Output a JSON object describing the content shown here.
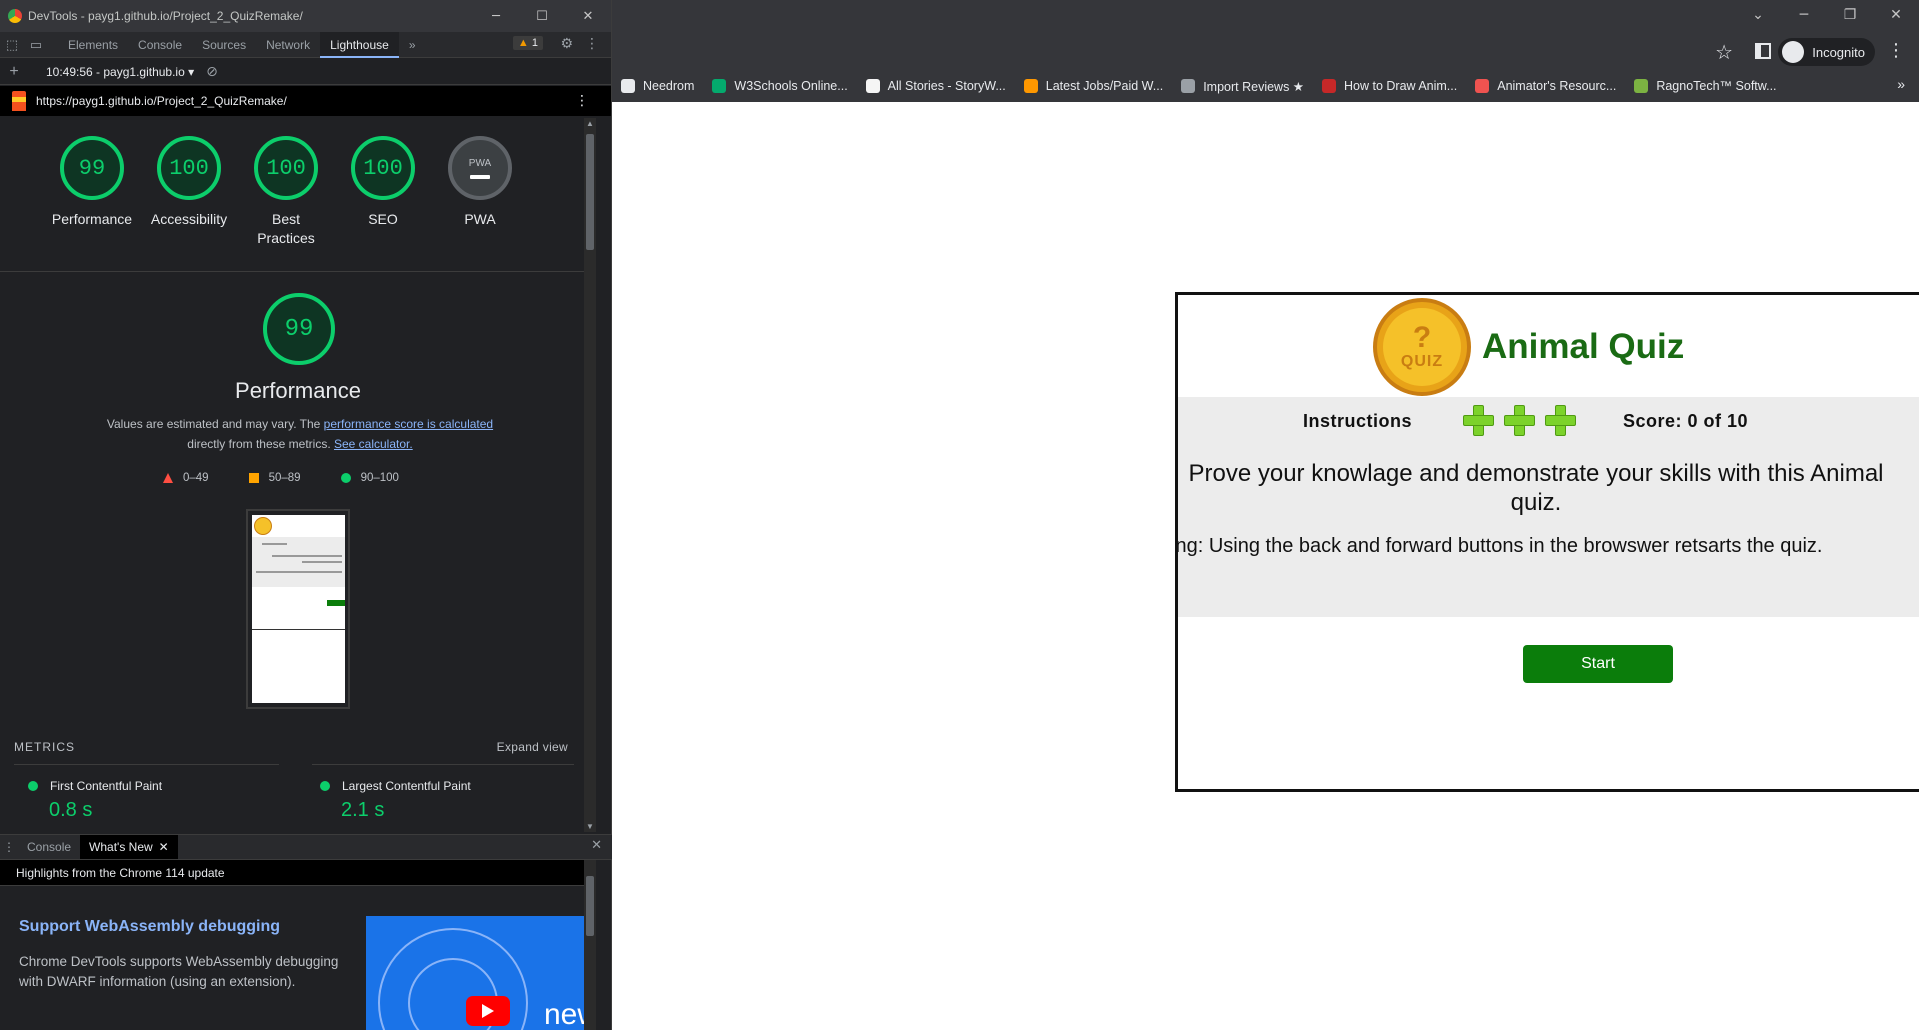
{
  "devtools": {
    "window_title": "DevTools - payg1.github.io/Project_2_QuizRemake/",
    "tabs": [
      "Elements",
      "Console",
      "Sources",
      "Network",
      "Lighthouse"
    ],
    "active_tab": "Lighthouse",
    "more_tabs": "»",
    "issues_count": "1",
    "report_selector": "10:49:56 - payg1.github.io",
    "report_url": "https://payg1.github.io/Project_2_QuizRemake/",
    "scores": [
      {
        "label": "Performance",
        "value": "99"
      },
      {
        "label": "Accessibility",
        "value": "100"
      },
      {
        "label": "Best Practices",
        "value": "100"
      },
      {
        "label": "SEO",
        "value": "100"
      }
    ],
    "pwa": {
      "label": "PWA",
      "badge": "PWA"
    },
    "performance": {
      "score": "99",
      "title": "Performance",
      "desc_1": "Values are estimated and may vary. The ",
      "desc_link_1": "performance score is calculated",
      "desc_2": " directly from these metrics. ",
      "desc_link_2": "See calculator.",
      "legend": [
        {
          "range": "0–49",
          "shape": "triangle",
          "color": "#ff4e42"
        },
        {
          "range": "50–89",
          "shape": "square",
          "color": "#ffa400"
        },
        {
          "range": "90–100",
          "shape": "circle",
          "color": "#0cce6b"
        }
      ]
    },
    "metrics": {
      "header": "METRICS",
      "expand": "Expand view",
      "items": [
        {
          "name": "First Contentful Paint",
          "value": "0.8 s"
        },
        {
          "name": "Largest Contentful Paint",
          "value": "2.1 s"
        }
      ]
    },
    "drawer": {
      "tabs": [
        "Console",
        "What's New"
      ],
      "active_tab": "What's New",
      "highlight": "Highlights from the Chrome 114 update",
      "feature_title": "Support WebAssembly debugging",
      "feature_text": "Chrome DevTools supports WebAssembly debugging with DWARF information (using an extension).",
      "video_text": "new"
    }
  },
  "browser": {
    "profile": "Incognito",
    "bookmarks": [
      {
        "label": "Needrom",
        "color": "#e8eaed"
      },
      {
        "label": "W3Schools Online...",
        "color": "#04aa6d"
      },
      {
        "label": "All Stories - StoryW...",
        "color": "#f5f5f5"
      },
      {
        "label": "Latest Jobs/Paid W...",
        "color": "#ff9800"
      },
      {
        "label": "Import Reviews ★",
        "color": "#9aa0a6"
      },
      {
        "label": "How to Draw Anim...",
        "color": "#c62828"
      },
      {
        "label": "Animator's Resourc...",
        "color": "#ef5350"
      },
      {
        "label": "RagnoTech™ Softw...",
        "color": "#7cb342"
      }
    ],
    "bookmarks_more": "»"
  },
  "quiz": {
    "title": "Animal Quiz",
    "logo_mark": "?",
    "logo_word": "QUIZ",
    "instructions": "Instructions",
    "lives": 3,
    "score": "Score: 0 of 10",
    "intro": "Prove your knowlage and demonstrate your skills with this Animal quiz.",
    "warning": "Warning: Using the back and forward buttons in the browswer retsarts the quiz.",
    "start": "Start"
  }
}
